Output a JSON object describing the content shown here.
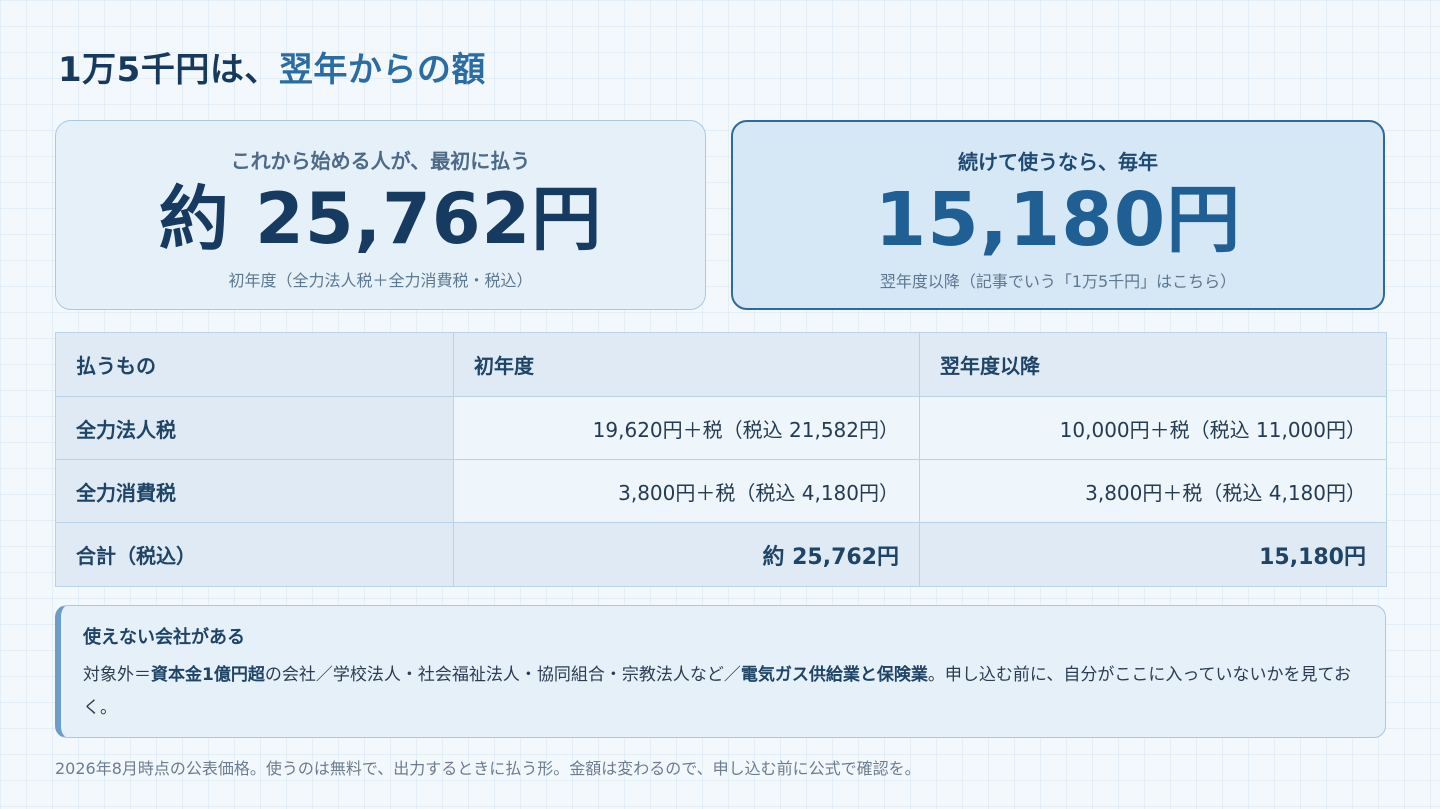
{
  "headline": {
    "prefix": "1万5千円は、",
    "accent": "翌年からの額"
  },
  "cards": {
    "first_year": {
      "label": "これから始める人が、最初に払う",
      "amount": "約 25,762円",
      "note": "初年度（全力法人税＋全力消費税・税込）"
    },
    "following_years": {
      "label": "続けて使うなら、毎年",
      "amount": "15,180円",
      "note": "翌年度以降（記事でいう「1万5千円」はこちら）"
    }
  },
  "table": {
    "headers": [
      "払うもの",
      "初年度",
      "翌年度以降"
    ],
    "rows": [
      {
        "item": "全力法人税",
        "first_year": "19,620円＋税（税込 21,582円）",
        "following": "10,000円＋税（税込 11,000円）"
      },
      {
        "item": "全力消費税",
        "first_year": "3,800円＋税（税込 4,180円）",
        "following": "3,800円＋税（税込 4,180円）"
      }
    ],
    "total": {
      "item": "合計（税込）",
      "first_year": "約 25,762円",
      "following": "15,180円"
    }
  },
  "notice": {
    "title": "使えない会社がある",
    "body_1": "対象外＝",
    "body_strong_1": "資本金1億円超",
    "body_2": "の会社／学校法人・社会福祉法人・協同組合・宗教法人など／",
    "body_strong_2": "電気ガス供給業と保険業",
    "body_3": "。申し込む前に、自分がここに入っていないかを見ておく。"
  },
  "footer": "2026年8月時点の公表価格。使うのは無料で、出力するときに払う形。金額は変わるので、申し込む前に公式で確認を。"
}
